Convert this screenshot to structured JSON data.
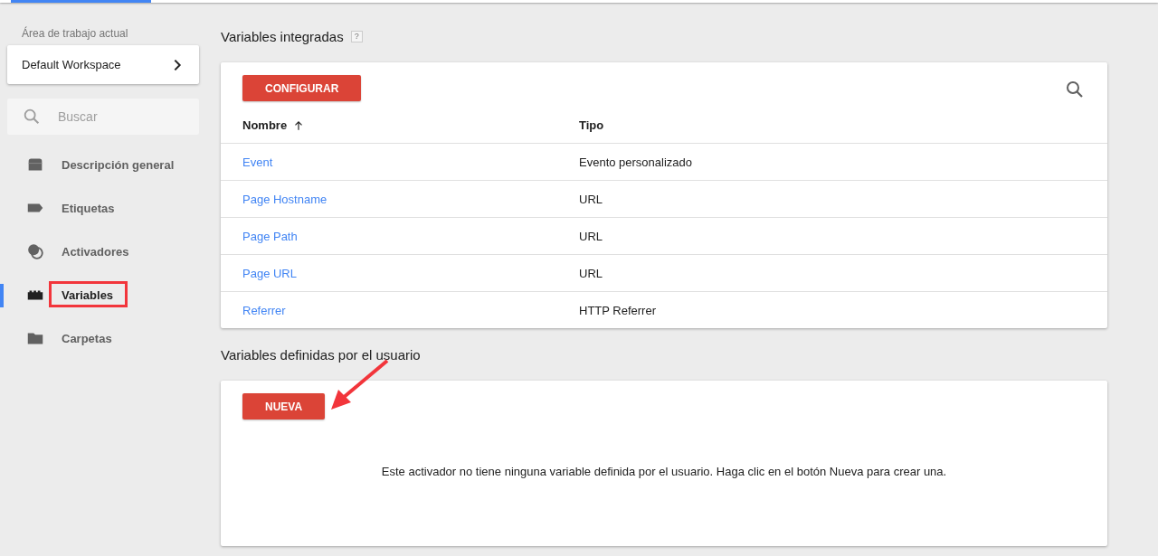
{
  "sidebar": {
    "workspace_label": "Área de trabajo actual",
    "workspace_name": "Default Workspace",
    "search": {
      "placeholder": "Buscar"
    },
    "items": [
      {
        "label": "Descripción general",
        "kind": "overview",
        "selected": false,
        "annotated": false
      },
      {
        "label": "Etiquetas",
        "kind": "tag",
        "selected": false,
        "annotated": false
      },
      {
        "label": "Activadores",
        "kind": "trigger",
        "selected": false,
        "annotated": false
      },
      {
        "label": "Variables",
        "kind": "blocks",
        "selected": true,
        "annotated": true
      },
      {
        "label": "Carpetas",
        "kind": "folder",
        "selected": false,
        "annotated": false
      }
    ]
  },
  "builtin": {
    "title": "Variables integradas",
    "help": "?",
    "button": "CONFIGURAR",
    "columns": [
      {
        "label": "Nombre",
        "sorted": true
      },
      {
        "label": "Tipo",
        "sorted": false
      }
    ],
    "rows": [
      {
        "name": "Event",
        "type": "Evento personalizado"
      },
      {
        "name": "Page Hostname",
        "type": "URL"
      },
      {
        "name": "Page Path",
        "type": "URL"
      },
      {
        "name": "Page URL",
        "type": "URL"
      },
      {
        "name": "Referrer",
        "type": "HTTP Referrer"
      }
    ]
  },
  "user_defined": {
    "title": "Variables definidas por el usuario",
    "button": "NUEVA",
    "annotated": true,
    "empty_message": "Este activador no tiene ninguna variable definida por el usuario. Haga clic en el botón Nueva para crear una."
  }
}
